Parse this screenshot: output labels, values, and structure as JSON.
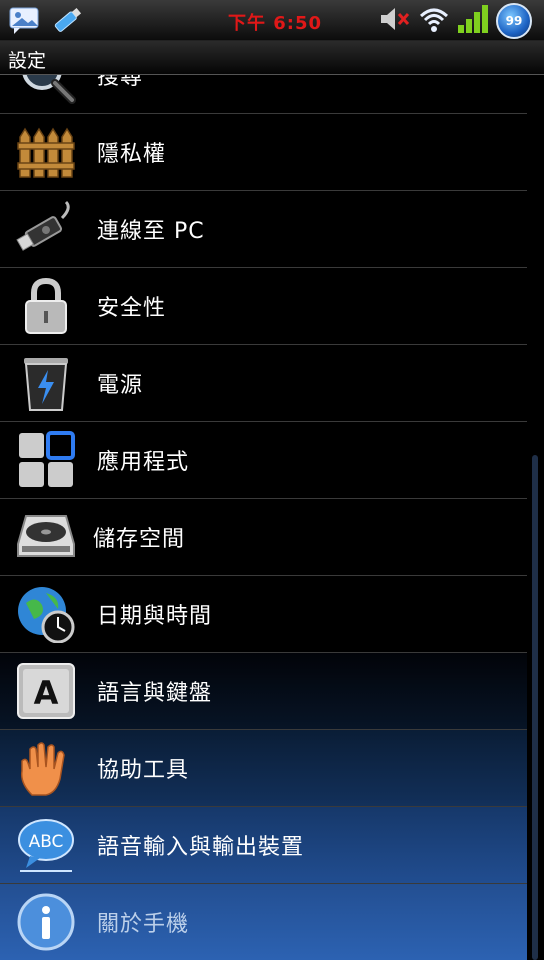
{
  "statusbar": {
    "time": "下午 6:50",
    "battery_level": "99"
  },
  "title": "設定",
  "menu": [
    {
      "label": "搜尋",
      "icon": "search-icon"
    },
    {
      "label": "隱私權",
      "icon": "fence-icon"
    },
    {
      "label": "連線至 PC",
      "icon": "usb-icon"
    },
    {
      "label": "安全性",
      "icon": "lock-icon"
    },
    {
      "label": "電源",
      "icon": "battery-bin-icon"
    },
    {
      "label": "應用程式",
      "icon": "apps-grid-icon"
    },
    {
      "label": "儲存空間",
      "icon": "hard-drive-icon"
    },
    {
      "label": "日期與時間",
      "icon": "globe-clock-icon"
    },
    {
      "label": "語言與鍵盤",
      "icon": "letter-a-key-icon"
    },
    {
      "label": "協助工具",
      "icon": "hand-icon"
    },
    {
      "label": "語音輸入與輸出裝置",
      "icon": "speech-bubble-abc-icon"
    },
    {
      "label": "關於手機",
      "icon": "info-icon"
    }
  ],
  "colors": {
    "clock": "#e01818",
    "accent": "#2c62b2"
  }
}
